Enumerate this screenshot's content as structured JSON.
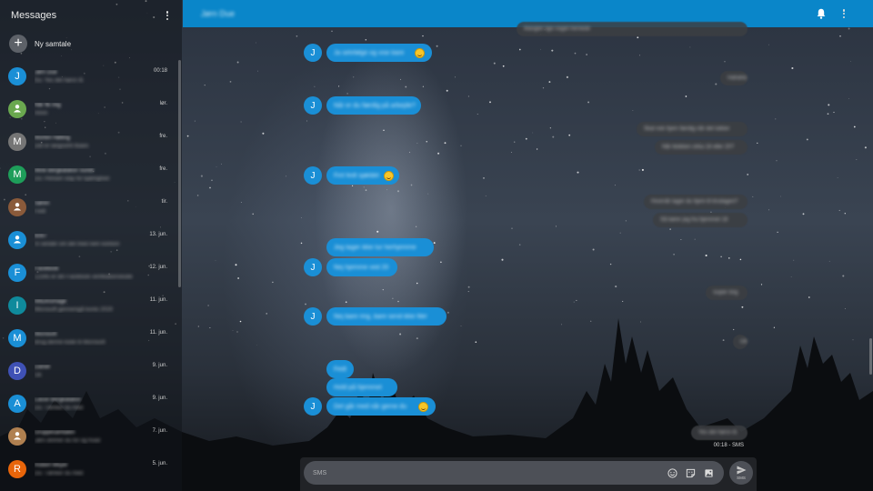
{
  "sidebar": {
    "title": "Messages",
    "new_chat_label": "Ny samtale",
    "conversations": [
      {
        "initial": "J",
        "color": "#1a8fd6",
        "name": "Jørn Due",
        "snippet": "Du: Yes det hørst rå",
        "date": "00:18"
      },
      {
        "initial": "",
        "color": "#6aa84f",
        "name": "Når fik mig",
        "snippet": "Hmm",
        "date": "lør."
      },
      {
        "initial": "M",
        "color": "#757575",
        "name": "Morten Hølling",
        "snippet": "Det er langsomt tkaws",
        "date": "fre."
      },
      {
        "initial": "M",
        "color": "#1e9e5a",
        "name": "Mine Bergkatalisn Sundt",
        "snippet": "Du: Pensen stay for kjærlighed",
        "date": "fre."
      },
      {
        "initial": "",
        "color": "#8a5a3a",
        "name": "Søren",
        "snippet": "Fedt",
        "date": "tir."
      },
      {
        "initial": "",
        "color": "#1a8fd6",
        "name": "6097",
        "snippet": "Vi sender om det med nem kontonr",
        "date": "13. jun."
      },
      {
        "initial": "F",
        "color": "#1a8fd6",
        "name": "Facebook",
        "snippet": "12345 er din Facebook verifikationskode",
        "date": "12. jun."
      },
      {
        "initial": "I",
        "color": "#0f8a9c",
        "name": "MitDinsmage",
        "snippet": "Microsoft gennemgå konto 2019",
        "date": "11. jun."
      },
      {
        "initial": "M",
        "color": "#1a8fd6",
        "name": "Microsoft",
        "snippet": "Brug denne kode til Microsoft",
        "date": "11. jun."
      },
      {
        "initial": "D",
        "color": "#3f51b5",
        "name": "Daniel",
        "snippet": "Ok",
        "date": "9. jun."
      },
      {
        "initial": "A",
        "color": "#1a8fd6",
        "name": "Lasse Bergkatalisn",
        "snippet": "Du: Tænker du med",
        "date": "9. jun."
      },
      {
        "initial": "",
        "color": "#b08050",
        "name": "Gruppesamtalen",
        "snippet": "Jørn dinmer du for og hvad",
        "date": "7. jun."
      },
      {
        "initial": "R",
        "color": "#e8650a",
        "name": "Robert Meyer",
        "snippet": "Du: Tænker du med",
        "date": "5. jun."
      }
    ]
  },
  "topbar": {
    "title": "Jørn Due",
    "bell_icon": "notification-bell-icon",
    "menu_icon": "more-vert-icon"
  },
  "messages": [
    {
      "dir": "out",
      "text": "Mangler lige noget hernede",
      "partial": true
    },
    {
      "dir": "in",
      "text": "Ja selvfølge og vise bare",
      "emoji": true
    },
    {
      "dir": "out",
      "text": "Hahaha"
    },
    {
      "dir": "in",
      "text": "Når er du færdig på arbejde?"
    },
    {
      "dir": "out",
      "text": "Skal nok hjem færdig når det lukker"
    },
    {
      "dir": "out",
      "text": "Når klokken cirka 18 eller 20?"
    },
    {
      "dir": "in",
      "text": "Fint fedt sjældet",
      "emoji": true
    },
    {
      "dir": "out",
      "text": "Hvornår tager du hjem til tirsdagen?"
    },
    {
      "dir": "out",
      "text": "Så kører jeg fra hjemmet 18"
    },
    {
      "dir": "in",
      "text": "Jeg tager ikke tur herhjemme"
    },
    {
      "dir": "in",
      "text": "Nej hjemme ved 20"
    },
    {
      "dir": "out",
      "text": "Super ting"
    },
    {
      "dir": "in",
      "text": "Nej bare ring, bare send ikke filer"
    },
    {
      "dir": "out",
      "text": "Ok"
    },
    {
      "dir": "in",
      "text": "Fedt"
    },
    {
      "dir": "in",
      "text": "Hold på hjemmet"
    },
    {
      "dir": "in",
      "text": "Det går med når gerne du",
      "emoji": true
    },
    {
      "dir": "out",
      "text": "Yes det hørst rå"
    }
  ],
  "last_meta": "00:18 - SMS",
  "compose": {
    "placeholder": "SMS",
    "send_label": "SMS",
    "icons": [
      "emoji-icon",
      "sticker-icon",
      "image-icon",
      "send-icon"
    ]
  },
  "avatar_initial": "J",
  "colors": {
    "accent": "#0a86c9",
    "bubble_in": "#1a8fd6",
    "bubble_out": "#3c3e42"
  }
}
